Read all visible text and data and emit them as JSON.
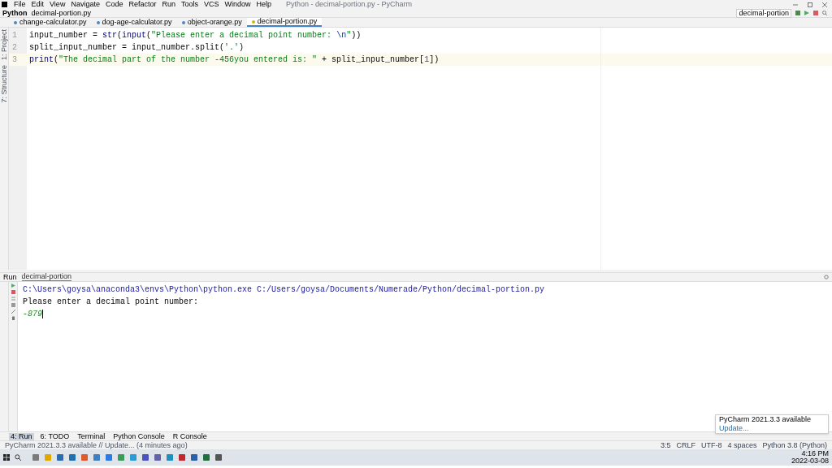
{
  "menu": [
    "File",
    "Edit",
    "View",
    "Navigate",
    "Code",
    "Refactor",
    "Run",
    "Tools",
    "VCS",
    "Window",
    "Help"
  ],
  "window": {
    "title": "Python - decimal-portion.py - PyCharm"
  },
  "breadcrumb": [
    "Python",
    "decimal-portion.py"
  ],
  "run_config": "decimal-portion",
  "side_tabs": [
    "1: Project",
    "7: Structure"
  ],
  "tabs": [
    {
      "label": "change-calculator.py",
      "selected": false
    },
    {
      "label": "dog-age-calculator.py",
      "selected": false
    },
    {
      "label": "object-orange.py",
      "selected": false
    },
    {
      "label": "decimal-portion.py",
      "selected": true
    }
  ],
  "editor": {
    "lines": [
      {
        "number": "1",
        "current": false,
        "tokens": [
          {
            "kind": "plain",
            "text": "input_number = "
          },
          {
            "kind": "builtin",
            "text": "str"
          },
          {
            "kind": "plain",
            "text": "("
          },
          {
            "kind": "builtin",
            "text": "input"
          },
          {
            "kind": "plain",
            "text": "("
          },
          {
            "kind": "string",
            "text": "\"Please enter a decimal point number: "
          },
          {
            "kind": "escape",
            "text": "\\n"
          },
          {
            "kind": "string",
            "text": "\""
          },
          {
            "kind": "plain",
            "text": "))"
          }
        ]
      },
      {
        "number": "2",
        "current": false,
        "tokens": [
          {
            "kind": "plain",
            "text": "split_input_number = input_number.split("
          },
          {
            "kind": "string",
            "text": "'.'"
          },
          {
            "kind": "plain",
            "text": ")"
          }
        ]
      },
      {
        "number": "3",
        "current": true,
        "tokens": [
          {
            "kind": "builtin",
            "text": "print"
          },
          {
            "kind": "plain",
            "text": "("
          },
          {
            "kind": "string",
            "text": "\"The decimal part of the number -456you entered is: \""
          },
          {
            "kind": "plain",
            "text": " + split_input_number["
          },
          {
            "kind": "number",
            "text": "1"
          },
          {
            "kind": "plain",
            "text": "])"
          }
        ]
      }
    ]
  },
  "run_panel": {
    "label": "Run",
    "tab": "decimal-portion",
    "output": [
      {
        "kind": "command",
        "text": "C:\\Users\\goysa\\anaconda3\\envs\\Python\\python.exe C:/Users/goysa/Documents/Numerade/Python/decimal-portion.py"
      },
      {
        "kind": "stdout",
        "text": "Please enter a decimal point number:"
      },
      {
        "kind": "input",
        "text": "-879"
      }
    ]
  },
  "tool_tabs": [
    {
      "label": "4: Run",
      "selected": true
    },
    {
      "label": "6: TODO",
      "selected": false
    },
    {
      "label": "Terminal",
      "selected": false
    },
    {
      "label": "Python Console",
      "selected": false
    },
    {
      "label": "R Console",
      "selected": false
    }
  ],
  "status_bar": {
    "message": "PyCharm 2021.3.3 available // Update... (4 minutes ago)",
    "items": [
      "3:5",
      "CRLF",
      "UTF-8",
      "4 spaces",
      "Python 3.8 (Python)"
    ]
  },
  "notification": {
    "title": "PyCharm 2021.3.3 available",
    "link": "Update..."
  },
  "taskbar": {
    "time": "4:16 PM",
    "date": "2022-03-08"
  }
}
